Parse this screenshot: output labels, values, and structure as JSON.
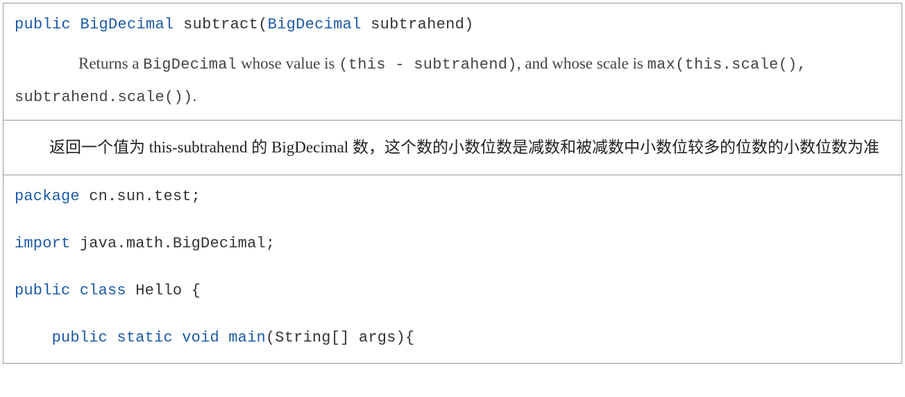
{
  "cell1": {
    "sig": {
      "kw_public": "public",
      "type1": "BigDecimal",
      "method": "subtract(",
      "type2": "BigDecimal",
      "param": " subtrahend)"
    },
    "desc": {
      "t1": "Returns a ",
      "m1": "BigDecimal",
      "t2": " whose value is ",
      "m2": "(this  -  subtrahend)",
      "t3": ", and whose scale is ",
      "m3": "max(this.scale(), subtrahend.scale())",
      "t4": "."
    }
  },
  "cell2": {
    "text": "返回一个值为 this-subtrahend 的 BigDecimal 数，这个数的小数位数是减数和被减数中小数位较多的位数的小数位数为准"
  },
  "cell3": {
    "line1": {
      "kw": "package",
      "rest": " cn.sun.test;"
    },
    "line2": {
      "kw": "import",
      "rest": " java.math.BigDecimal;"
    },
    "line3": {
      "kw1": "public",
      "kw2": "class",
      "rest": " Hello {"
    },
    "line4": {
      "indent": "    ",
      "kw1": "public",
      "kw2": "static",
      "kw3": "void",
      "fn": "main",
      "rest": "(String[] args){"
    }
  }
}
